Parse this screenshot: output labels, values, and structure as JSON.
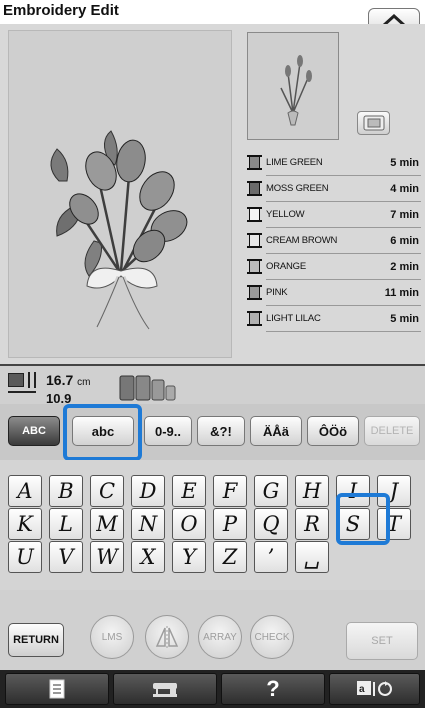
{
  "header": {
    "title": "Embroidery Edit"
  },
  "threads": [
    {
      "name": "LIME GREEN",
      "time": "5 min",
      "color": "#8a8a8a"
    },
    {
      "name": "MOSS GREEN",
      "time": "4 min",
      "color": "#6b6b6b"
    },
    {
      "name": "YELLOW",
      "time": "7 min",
      "color": "#f5f5f5"
    },
    {
      "name": "CREAM BROWN",
      "time": "6 min",
      "color": "#e8e8e8"
    },
    {
      "name": "ORANGE",
      "time": "2 min",
      "color": "#bdbdbd"
    },
    {
      "name": "PINK",
      "time": "11 min",
      "color": "#9a9a9a"
    },
    {
      "name": "LIGHT LILAC",
      "time": "5 min",
      "color": "#b0b0b0"
    }
  ],
  "info": {
    "width_value": "16.7",
    "width_unit": "cm",
    "height_value": "10.9"
  },
  "tabs": [
    "ABC",
    "abc",
    "0-9..",
    "&?!",
    "ÄÅä",
    "ÔÖö",
    "DELETE"
  ],
  "keys": {
    "row1": [
      "A",
      "B",
      "C",
      "D",
      "E",
      "F",
      "G",
      "H",
      "I",
      "J"
    ],
    "row2": [
      "K",
      "L",
      "M",
      "N",
      "O",
      "P",
      "Q",
      "R",
      "S",
      "T"
    ],
    "row3": [
      "U",
      "V",
      "W",
      "X",
      "Y",
      "Z",
      "’",
      "␣"
    ]
  },
  "functions": {
    "return_label": "RETURN",
    "lms_label": "LMS",
    "array_label": "ARRAY",
    "check_label": "CHECK",
    "set_label": "SET"
  },
  "bottom_bar": {
    "help_label": "?"
  }
}
